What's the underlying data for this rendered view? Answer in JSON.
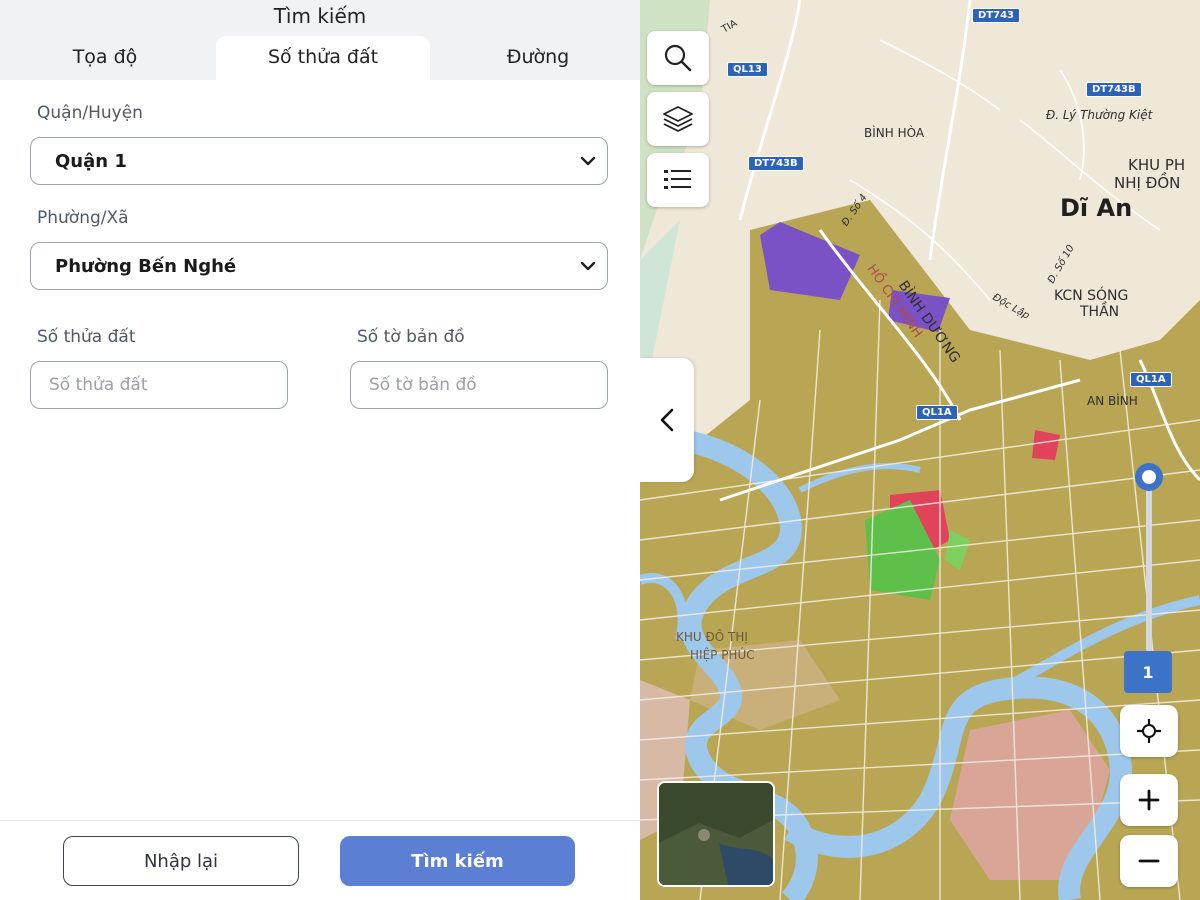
{
  "panel": {
    "title": "Tìm kiếm",
    "tabs": [
      {
        "label": "Tọa độ"
      },
      {
        "label": "Số thửa đất"
      },
      {
        "label": "Đường"
      }
    ],
    "active_tab": "Số thửa đất",
    "district": {
      "label": "Quận/Huyện",
      "value": "Quận 1"
    },
    "ward": {
      "label": "Phường/Xã",
      "value": "Phường Bến Nghé"
    },
    "parcel": {
      "label": "Số thửa đất",
      "placeholder": "Số thửa đất"
    },
    "map_sheet": {
      "label": "Số tờ bản đồ",
      "placeholder": "Số tờ bản đồ"
    },
    "reset_label": "Nhập lại",
    "search_label": "Tìm kiếm"
  },
  "map": {
    "labels": {
      "di_an": "Dĩ An",
      "binh_hoa": "BÌNH HÒA",
      "binh_duong": "BÌNH DƯƠNG",
      "khu_pho": "KHU PH",
      "nhi_dong": "NHỊ ĐỒN",
      "kcn_line1": "KCN SÓNG",
      "kcn_line2": "THẦN",
      "an_binh": "AN BÌNH",
      "ly_thuong_kiet": "Đ. Lý Thường Kiệt",
      "so4": "Đ. Số 4",
      "so10": "Đ. Số 10",
      "doc_lap": "Độc Lập",
      "ho_chi_minh": "HỒ CHÍ MINH",
      "tia": "TIA",
      "khu_do_thi": "KHU ĐÔ THỊ",
      "hiep_phuc": "HIỆP PHÚC"
    },
    "road_badges": [
      "DT743",
      "QL13",
      "DT743B",
      "DT743B",
      "QL1A",
      "QL1A"
    ],
    "zoom_level": "1",
    "colors": {
      "residential": "#b9a655",
      "commercial": "#e0435a",
      "park": "#5fbf4b",
      "water": "#9ec7ec",
      "industrial": "#7b52c6",
      "land": "#efe7d8"
    }
  }
}
